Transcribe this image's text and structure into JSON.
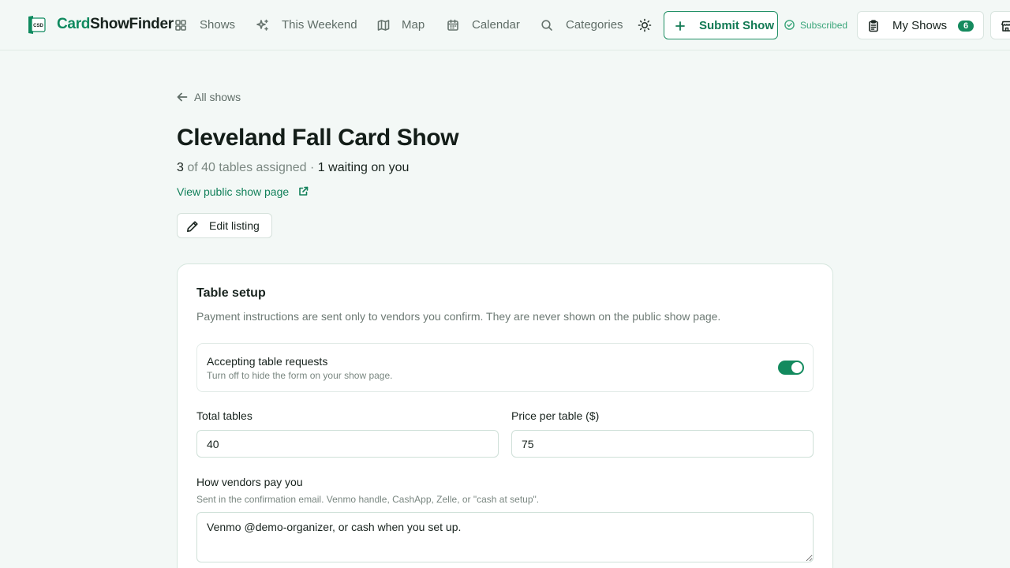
{
  "header": {
    "brand": {
      "part1": "Card",
      "part2": "ShowFinder",
      "logo_text": "CSD"
    },
    "nav": [
      {
        "label": "Shows",
        "icon": "grid-icon"
      },
      {
        "label": "This Weekend",
        "icon": "sparkles-icon"
      },
      {
        "label": "Map",
        "icon": "map-icon"
      },
      {
        "label": "Calendar",
        "icon": "calendar-icon"
      },
      {
        "label": "Categories",
        "icon": "search-icon"
      }
    ],
    "theme_toggle_icon": "sun-icon",
    "submit_label": "Submit Show",
    "subscribed_label": "Subscribed",
    "my_shows_label": "My Shows",
    "my_shows_count": "6",
    "store_icon": "store-icon"
  },
  "page": {
    "back_label": "All shows",
    "title": "Cleveland Fall Card Show",
    "assigned_count": "3",
    "of_total_text": " of 40 tables assigned · ",
    "waiting_text": "1 waiting on you",
    "public_link_label": "View public show page",
    "edit_label": "Edit listing"
  },
  "table_setup": {
    "title": "Table setup",
    "description": "Payment instructions are sent only to vendors you confirm. They are never shown on the public show page.",
    "accepting_title": "Accepting table requests",
    "accepting_hint": "Turn off to hide the form on your show page.",
    "accepting_on": true,
    "total_tables_label": "Total tables",
    "total_tables_value": "40",
    "price_label": "Price per table ($)",
    "price_value": "75",
    "payment_label": "How vendors pay you",
    "payment_hint": "Sent in the confirmation email. Venmo handle, CashApp, Zelle, or \"cash at setup\".",
    "payment_value": "Venmo @demo-organizer, or cash when you set up."
  },
  "colors": {
    "brand_green": "#0f8a5f",
    "background": "#f3f8f6",
    "toggle_on": "#138a5e"
  }
}
